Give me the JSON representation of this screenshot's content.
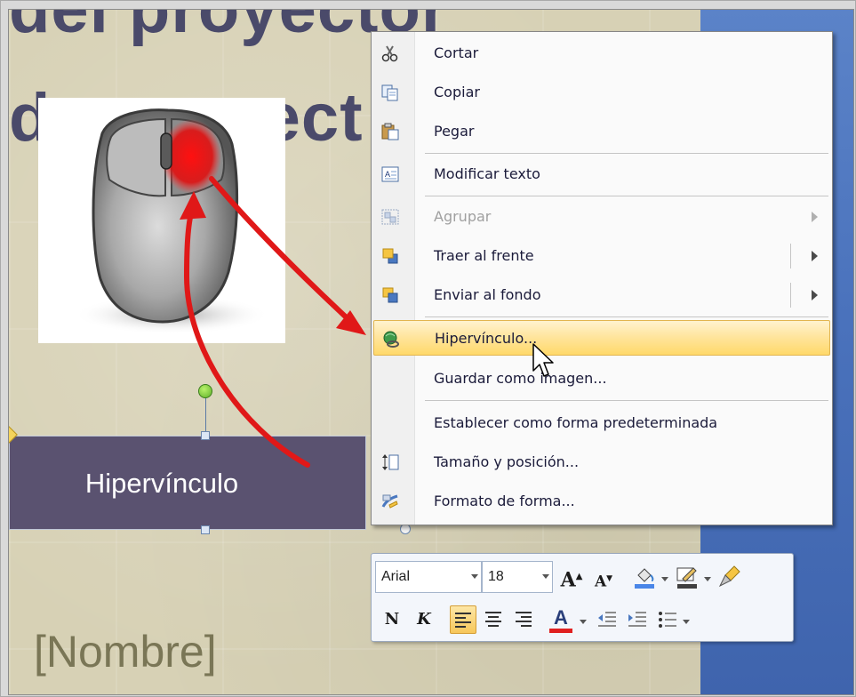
{
  "slide": {
    "title_line_1": "del proyector",
    "title_line_2": "do proyect",
    "shape_label": "Hipervínculo",
    "placeholder": "[Nombre]"
  },
  "context_menu": {
    "items": [
      {
        "label": "Cortar",
        "icon": "scissors-icon",
        "enabled": true
      },
      {
        "label": "Copiar",
        "icon": "copy-icon",
        "enabled": true
      },
      {
        "label": "Pegar",
        "icon": "paste-icon",
        "enabled": true
      },
      {
        "label": "Modificar texto",
        "icon": "edit-text-icon",
        "enabled": true
      },
      {
        "label": "Agrupar",
        "icon": "group-icon",
        "enabled": false,
        "submenu": true
      },
      {
        "label": "Traer al frente",
        "icon": "bring-front-icon",
        "enabled": true,
        "submenu": true,
        "split": true
      },
      {
        "label": "Enviar al fondo",
        "icon": "send-back-icon",
        "enabled": true,
        "submenu": true,
        "split": true
      },
      {
        "label": "Hipervínculo...",
        "icon": "hyperlink-icon",
        "enabled": true,
        "highlighted": true
      },
      {
        "label": "Guardar como imagen...",
        "icon": "",
        "enabled": true
      },
      {
        "label": "Establecer como forma predeterminada",
        "icon": "",
        "enabled": true
      },
      {
        "label": "Tamaño y posición...",
        "icon": "size-position-icon",
        "enabled": true
      },
      {
        "label": "Formato de forma...",
        "icon": "format-shape-icon",
        "enabled": true
      }
    ]
  },
  "mini_toolbar": {
    "font_name": "Arial",
    "font_size": "18",
    "grow_font": "A",
    "shrink_font": "A",
    "bold": "N",
    "italic": "K",
    "font_color_letter": "A",
    "colors": {
      "fill": "#4a86e8",
      "line": "#404040",
      "font": "#e02020",
      "highlight_active": "#f7c75a"
    }
  },
  "colors": {
    "menu_highlight": "#ffd96a",
    "shape_fill": "#5a5270",
    "slide_background": "#d7d1b5",
    "side_panel": "#4a72bc",
    "annotation_arrows": "#e01818"
  }
}
